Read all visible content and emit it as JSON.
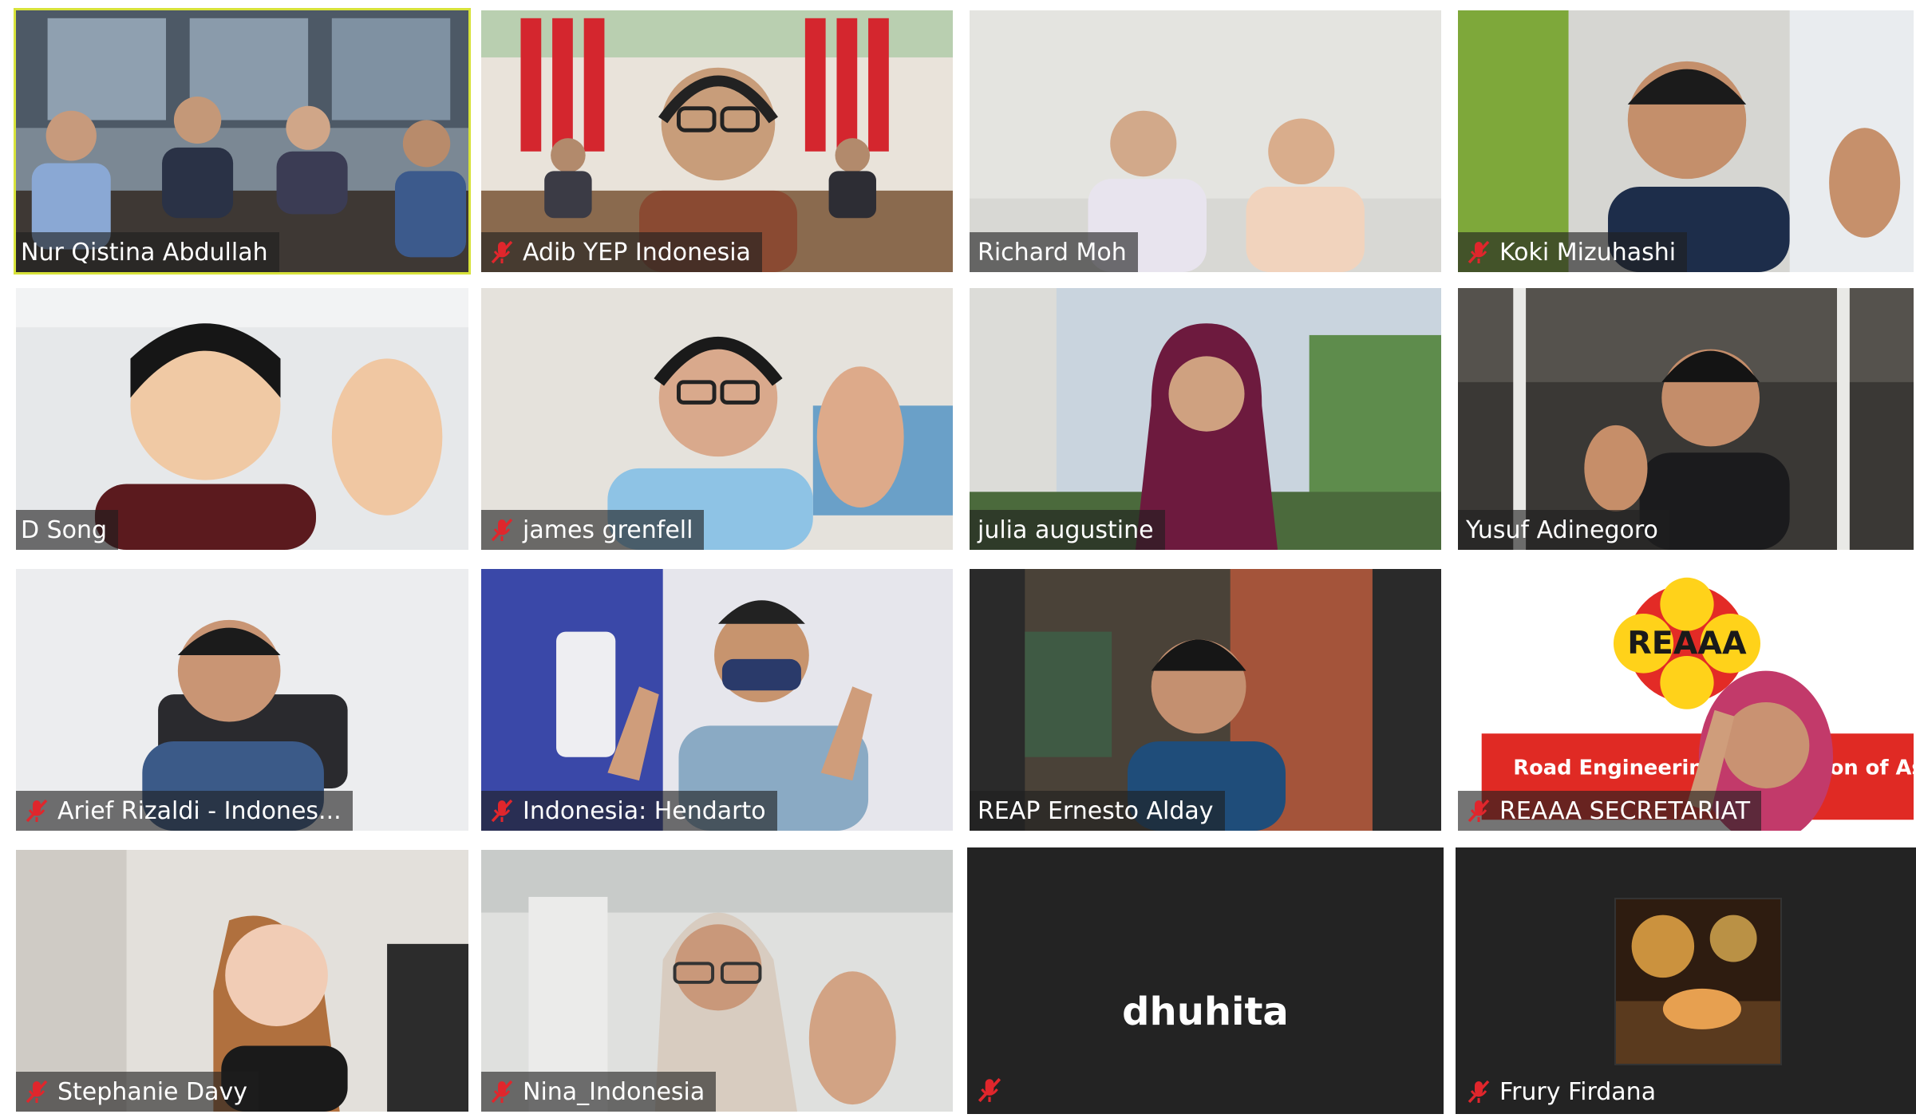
{
  "meeting": {
    "view": "gallery",
    "participants": [
      {
        "name": "Nur Qistina Abdullah",
        "muted": false,
        "active_speaker": true,
        "video": true
      },
      {
        "name": "Adib YEP Indonesia",
        "muted": true,
        "active_speaker": false,
        "video": true
      },
      {
        "name": "Richard Moh",
        "muted": false,
        "active_speaker": false,
        "video": true
      },
      {
        "name": "Koki Mizuhashi",
        "muted": true,
        "active_speaker": false,
        "video": true
      },
      {
        "name": "D Song",
        "muted": false,
        "active_speaker": false,
        "video": true
      },
      {
        "name": "james grenfell",
        "muted": true,
        "active_speaker": false,
        "video": true
      },
      {
        "name": "julia augustine",
        "muted": false,
        "active_speaker": false,
        "video": true
      },
      {
        "name": "Yusuf Adinegoro",
        "muted": false,
        "active_speaker": false,
        "video": true
      },
      {
        "name": "Arief Rizaldi - Indones...",
        "muted": true,
        "active_speaker": false,
        "video": true
      },
      {
        "name": "Indonesia: Hendarto",
        "muted": true,
        "active_speaker": false,
        "video": true
      },
      {
        "name": "REAP Ernesto Alday",
        "muted": false,
        "active_speaker": false,
        "video": true
      },
      {
        "name": "REAAA SECRETARIAT",
        "muted": true,
        "active_speaker": false,
        "video": true
      },
      {
        "name": "Stephanie Davy",
        "muted": true,
        "active_speaker": false,
        "video": true
      },
      {
        "name": "Nina_Indonesia",
        "muted": true,
        "active_speaker": false,
        "video": true
      },
      {
        "name": "dhuhita",
        "muted": true,
        "active_speaker": false,
        "video": false
      },
      {
        "name": "Frury Firdana",
        "muted": true,
        "active_speaker": false,
        "video": false
      }
    ]
  },
  "reaaa_logo": {
    "text": "REAAA",
    "banner": "Road Engineering Association of Asia"
  },
  "colors": {
    "active_border": "#d7e23a",
    "muted_icon": "#e0262c",
    "name_bar": "rgba(30,30,30,0.62)",
    "no_video_bg": "#232323",
    "gap": "#ffffff"
  },
  "icons": {
    "muted": "mic-muted-icon"
  }
}
